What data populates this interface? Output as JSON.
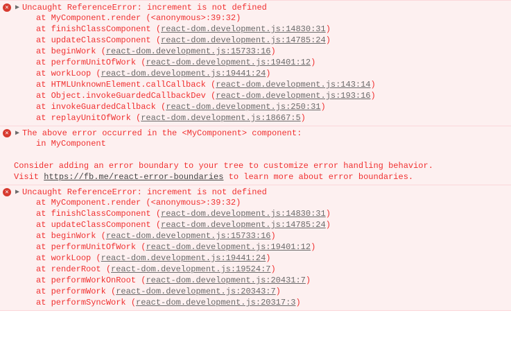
{
  "messages": [
    {
      "headline": "Uncaught ReferenceError: increment is not defined",
      "stack": [
        {
          "fn": "MyComponent.render",
          "src": "<anonymous>:39:32",
          "linked": false
        },
        {
          "fn": "finishClassComponent",
          "src": "react-dom.development.js:14830:31",
          "linked": true
        },
        {
          "fn": "updateClassComponent",
          "src": "react-dom.development.js:14785:24",
          "linked": true
        },
        {
          "fn": "beginWork",
          "src": "react-dom.development.js:15733:16",
          "linked": true
        },
        {
          "fn": "performUnitOfWork",
          "src": "react-dom.development.js:19401:12",
          "linked": true
        },
        {
          "fn": "workLoop",
          "src": "react-dom.development.js:19441:24",
          "linked": true
        },
        {
          "fn": "HTMLUnknownElement.callCallback",
          "src": "react-dom.development.js:143:14",
          "linked": true
        },
        {
          "fn": "Object.invokeGuardedCallbackDev",
          "src": "react-dom.development.js:193:16",
          "linked": true
        },
        {
          "fn": "invokeGuardedCallback",
          "src": "react-dom.development.js:250:31",
          "linked": true
        },
        {
          "fn": "replayUnitOfWork",
          "src": "react-dom.development.js:18667:5",
          "linked": true
        }
      ]
    },
    {
      "headline": "The above error occurred in the <MyComponent> component:",
      "body_lines": [
        {
          "text": "in MyComponent",
          "indent": 48
        },
        {
          "text": "",
          "indent": 48
        },
        {
          "text": "Consider adding an error boundary to your tree to customize error handling behavior.",
          "indent": 16
        },
        {
          "text": "Visit https://fb.me/react-error-boundaries to learn more about error boundaries.",
          "indent": 16,
          "link_text": "https://fb.me/react-error-boundaries",
          "before": "Visit ",
          "after": " to learn more about error boundaries."
        }
      ]
    },
    {
      "headline": "Uncaught ReferenceError: increment is not defined",
      "stack": [
        {
          "fn": "MyComponent.render",
          "src": "<anonymous>:39:32",
          "linked": false
        },
        {
          "fn": "finishClassComponent",
          "src": "react-dom.development.js:14830:31",
          "linked": true
        },
        {
          "fn": "updateClassComponent",
          "src": "react-dom.development.js:14785:24",
          "linked": true
        },
        {
          "fn": "beginWork",
          "src": "react-dom.development.js:15733:16",
          "linked": true
        },
        {
          "fn": "performUnitOfWork",
          "src": "react-dom.development.js:19401:12",
          "linked": true
        },
        {
          "fn": "workLoop",
          "src": "react-dom.development.js:19441:24",
          "linked": true
        },
        {
          "fn": "renderRoot",
          "src": "react-dom.development.js:19524:7",
          "linked": true
        },
        {
          "fn": "performWorkOnRoot",
          "src": "react-dom.development.js:20431:7",
          "linked": true
        },
        {
          "fn": "performWork",
          "src": "react-dom.development.js:20343:7",
          "linked": true
        },
        {
          "fn": "performSyncWork",
          "src": "react-dom.development.js:20317:3",
          "linked": true
        }
      ]
    }
  ]
}
